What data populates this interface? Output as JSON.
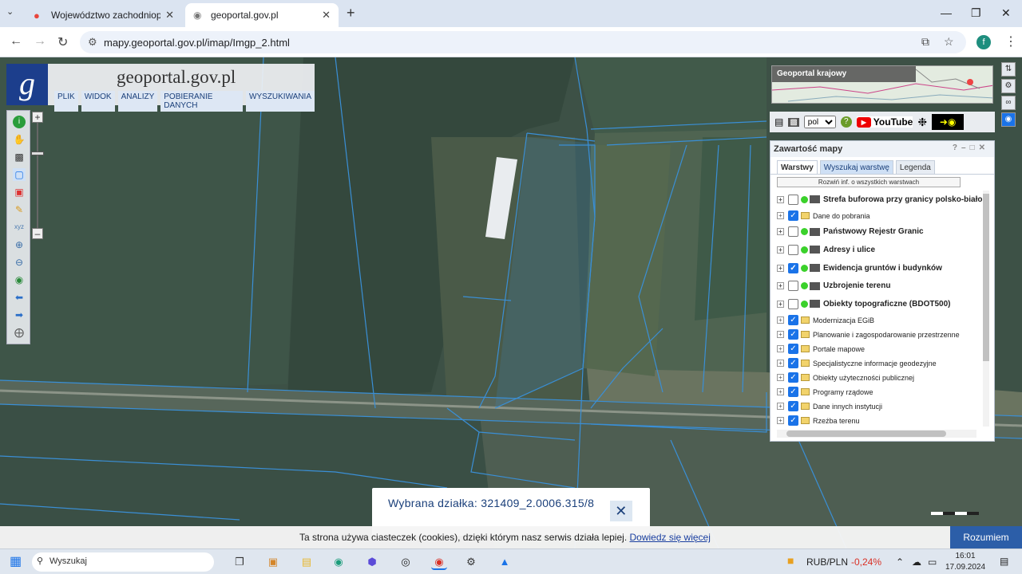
{
  "browser": {
    "tabs": [
      {
        "title": "Województwo zachodniopomorskie",
        "active": false
      },
      {
        "title": "geoportal.gov.pl",
        "active": true
      }
    ],
    "url": "mapy.geoportal.gov.pl/imap/Imgp_2.html",
    "profile_initial": "f"
  },
  "geoportal": {
    "logo_text": "geoportal.gov.pl",
    "menu": [
      "PLIK",
      "WIDOK",
      "ANALIZY",
      "POBIERANIE DANYCH",
      "WYSZUKIWANIA"
    ],
    "overview_label": "Geoportal krajowy",
    "language": "pol",
    "youtube_label": "YouTube"
  },
  "panel": {
    "title": "Zawartość mapy",
    "tabs": [
      "Warstwy",
      "Wyszukaj warstwę",
      "Legenda"
    ],
    "expand_all": "Rozwiń inf. o wszystkich warstwach",
    "layers": [
      {
        "name": "Strefa buforowa przy granicy polsko-biało",
        "checked": false,
        "kind": "wms",
        "bold": true
      },
      {
        "name": "Dane do pobrania",
        "checked": true,
        "kind": "folder",
        "bold": false
      },
      {
        "name": "Państwowy Rejestr Granic",
        "checked": false,
        "kind": "wms",
        "bold": true
      },
      {
        "name": "Adresy i ulice",
        "checked": false,
        "kind": "wms",
        "bold": true
      },
      {
        "name": "Ewidencja gruntów i budynków",
        "checked": true,
        "kind": "wms",
        "bold": true
      },
      {
        "name": "Uzbrojenie terenu",
        "checked": false,
        "kind": "wms",
        "bold": true
      },
      {
        "name": "Obiekty topograficzne (BDOT500)",
        "checked": false,
        "kind": "wms",
        "bold": true
      },
      {
        "name": "Modernizacja EGiB",
        "checked": true,
        "kind": "folder",
        "bold": false
      },
      {
        "name": "Planowanie i zagospodarowanie przestrzenne",
        "checked": true,
        "kind": "folder",
        "bold": false
      },
      {
        "name": "Portale mapowe",
        "checked": true,
        "kind": "folder",
        "bold": false
      },
      {
        "name": "Specjalistyczne informacje geodezyjne",
        "checked": true,
        "kind": "folder",
        "bold": false
      },
      {
        "name": "Obiekty użyteczności publicznej",
        "checked": true,
        "kind": "folder",
        "bold": false
      },
      {
        "name": "Programy rządowe",
        "checked": true,
        "kind": "folder",
        "bold": false
      },
      {
        "name": "Dane innych instytucji",
        "checked": true,
        "kind": "folder",
        "bold": false
      },
      {
        "name": "Rzeźba terenu",
        "checked": true,
        "kind": "folder",
        "bold": false
      }
    ]
  },
  "selection": {
    "text": "Wybrana działka: 321409_2.0006.315/8"
  },
  "cookie": {
    "message": "Ta strona używa ciasteczek (cookies), dzięki którym nasz serwis działa lepiej.",
    "link": "Dowiedz się więcej",
    "button": "Rozumiem"
  },
  "taskbar": {
    "search_text": "Wyszukaj",
    "currency_pair": "RUB/PLN",
    "currency_change": "-0,24%",
    "time": "16:01",
    "date": "17.09.2024"
  },
  "colors": {
    "parcel_line": "#3a8fd6",
    "brand_blue": "#1c3e8c",
    "negative": "#d93025"
  }
}
